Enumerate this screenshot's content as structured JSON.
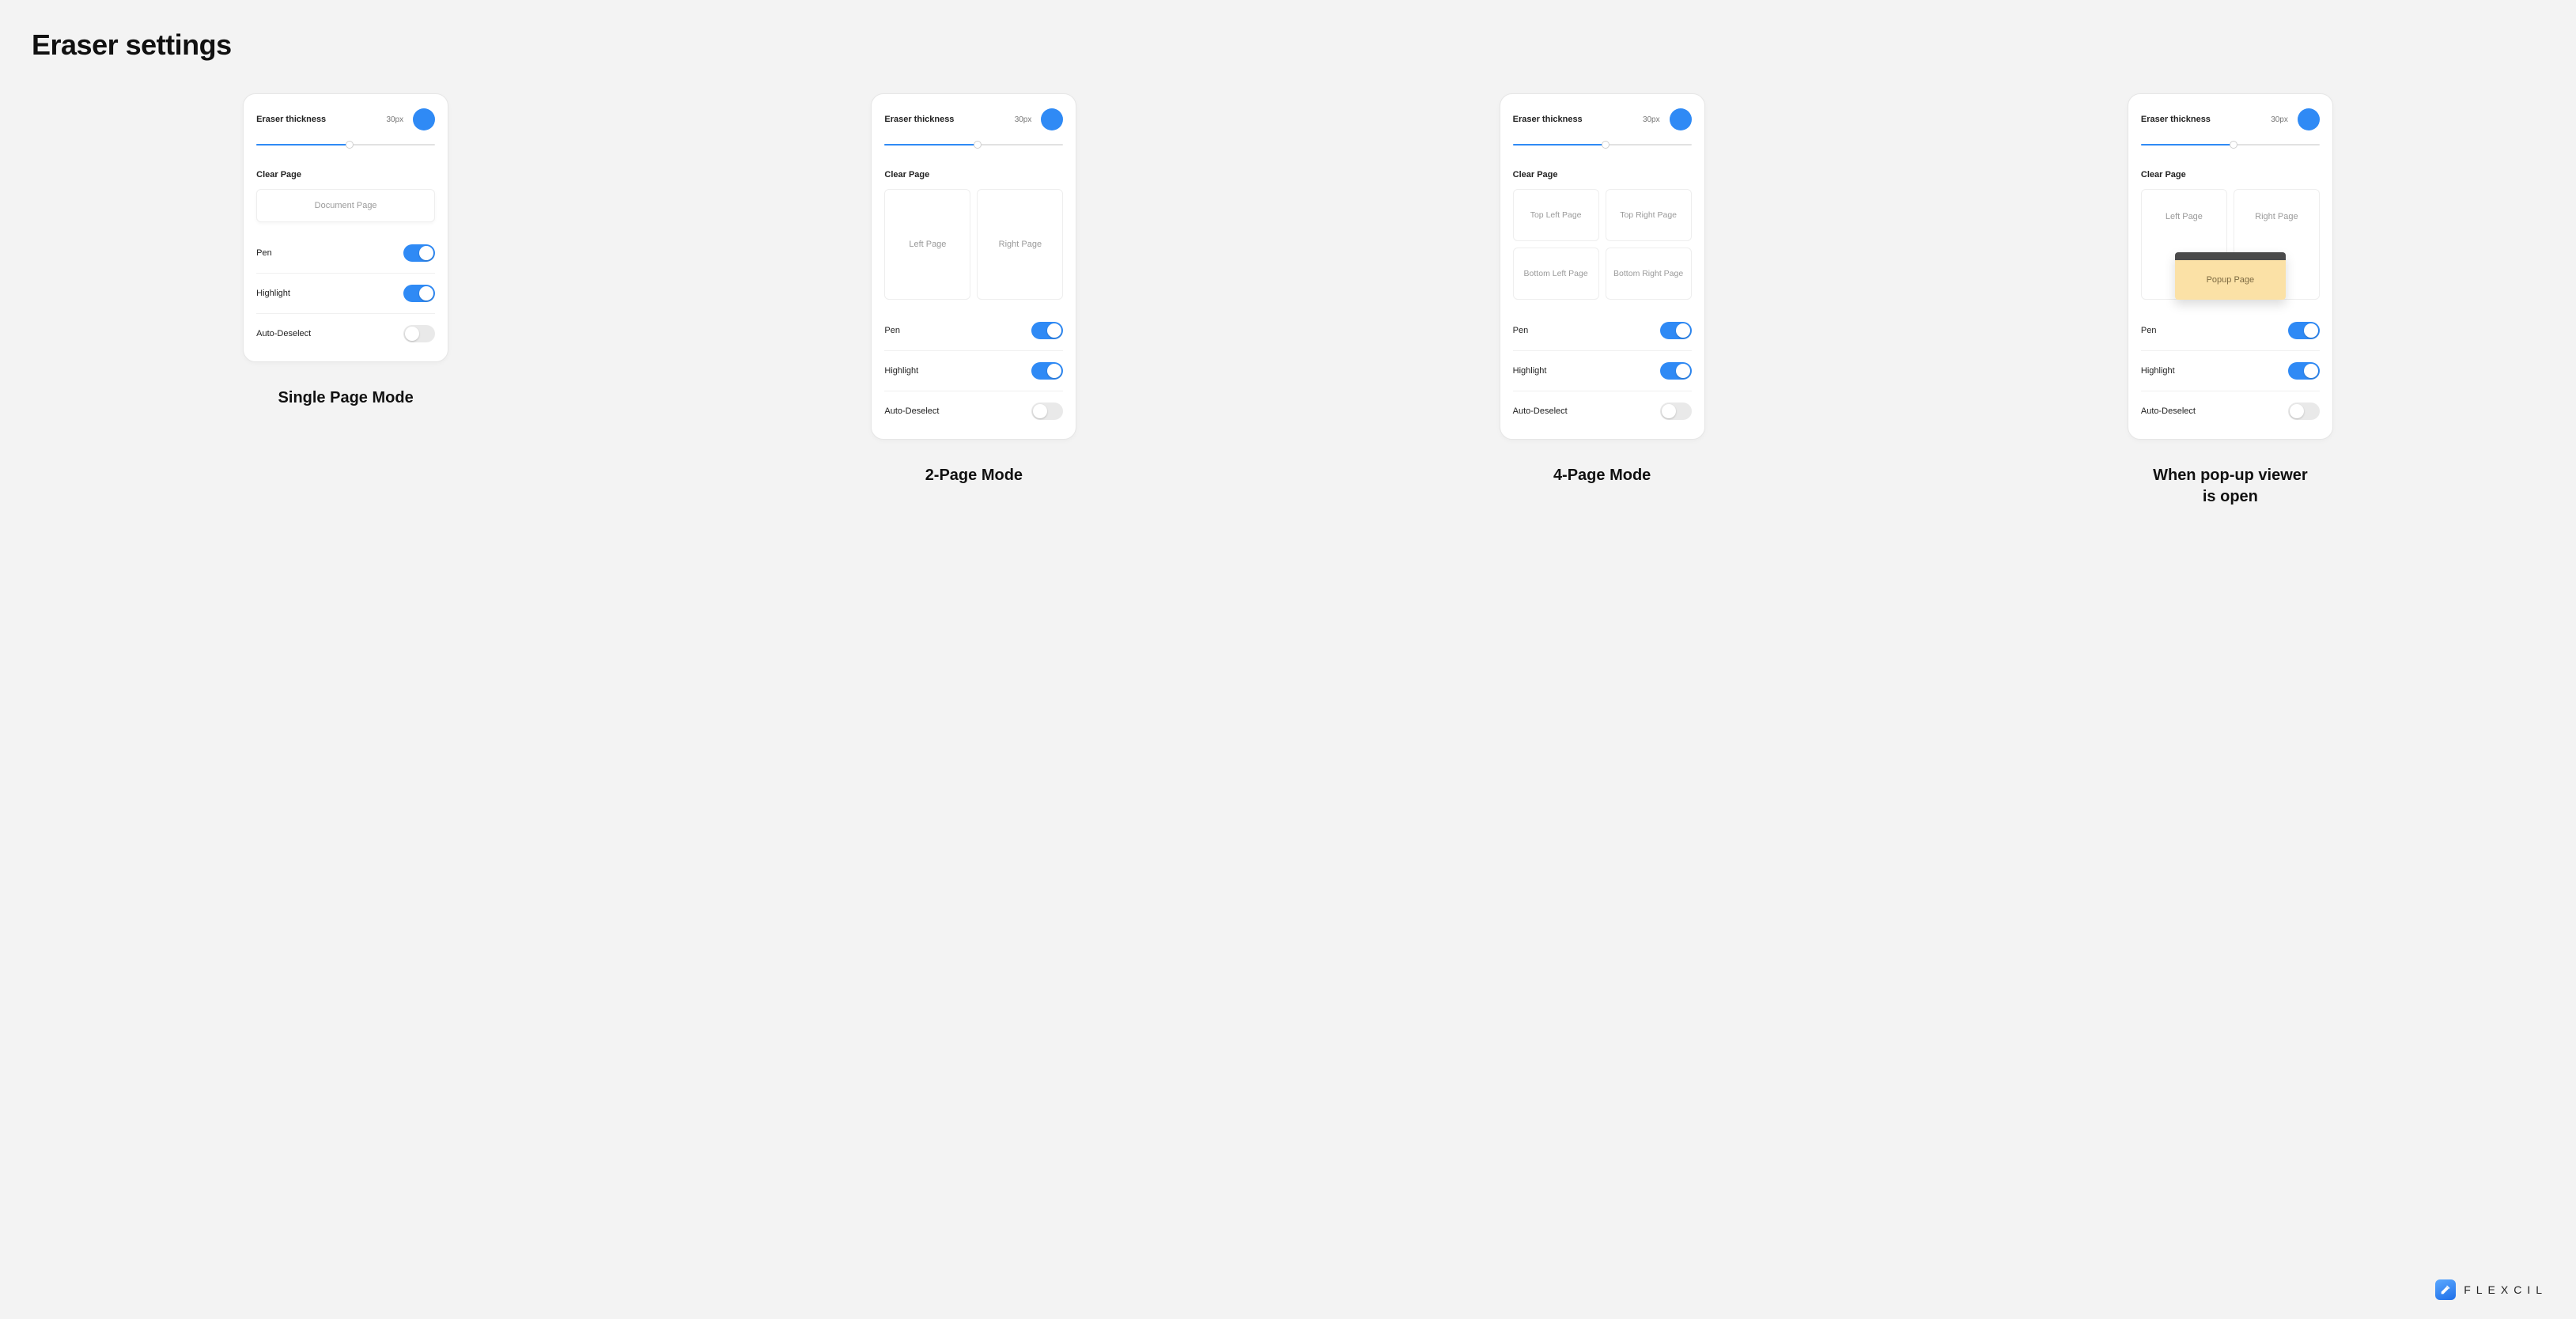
{
  "title": "Eraser settings",
  "brand": "FLEXCIL",
  "common": {
    "thickness_label": "Eraser thickness",
    "thickness_value": "30px",
    "slider_percent": 52,
    "clear_page_label": "Clear Page",
    "toggles": {
      "pen": {
        "label": "Pen",
        "on": true
      },
      "highlight": {
        "label": "Highlight",
        "on": true
      },
      "auto_deselect": {
        "label": "Auto-Deselect",
        "on": false
      }
    }
  },
  "panels": [
    {
      "id": "single",
      "caption": "Single Page Mode",
      "clear_layout": "single",
      "buttons": [
        "Document Page"
      ]
    },
    {
      "id": "two",
      "caption": "2-Page Mode",
      "clear_layout": "two",
      "buttons": [
        "Left Page",
        "Right Page"
      ]
    },
    {
      "id": "four",
      "caption": "4-Page Mode",
      "clear_layout": "four",
      "buttons": [
        "Top Left Page",
        "Top Right Page",
        "Bottom Left Page",
        "Bottom Right Page"
      ]
    },
    {
      "id": "popup",
      "caption": "When pop-up viewer\nis open",
      "clear_layout": "popup",
      "buttons": [
        "Left Page",
        "Right Page"
      ],
      "popup_label": "Popup Page"
    }
  ]
}
